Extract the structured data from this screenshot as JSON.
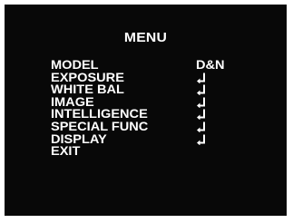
{
  "menu": {
    "title": "MENU",
    "items": [
      {
        "label": "MODEL",
        "value": "D&N",
        "icon": ""
      },
      {
        "label": "EXPOSURE",
        "value": "",
        "icon": "enter-icon"
      },
      {
        "label": "WHITE BAL",
        "value": "",
        "icon": "enter-icon"
      },
      {
        "label": "IMAGE",
        "value": "",
        "icon": "enter-icon"
      },
      {
        "label": "INTELLIGENCE",
        "value": "",
        "icon": "enter-icon"
      },
      {
        "label": "SPECIAL FUNC",
        "value": "",
        "icon": "enter-icon"
      },
      {
        "label": "DISPLAY",
        "value": "",
        "icon": "enter-icon"
      },
      {
        "label": "EXIT",
        "value": "",
        "icon": ""
      }
    ]
  },
  "colors": {
    "background": "#080808",
    "text": "#ffffff",
    "frame": "#ffffff"
  }
}
